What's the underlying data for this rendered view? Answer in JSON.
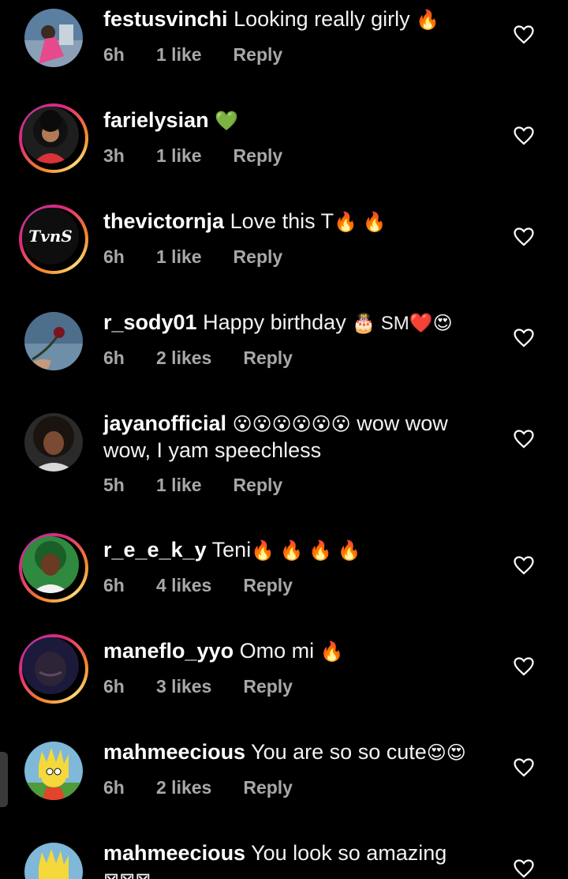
{
  "comments": [
    {
      "username": "festusvinchi",
      "text": "Looking really girly",
      "emoji": "🔥",
      "time": "6h",
      "likes": "1 like",
      "reply": "Reply"
    },
    {
      "username": "farielysian",
      "text": "",
      "emoji": "💚",
      "time": "3h",
      "likes": "1 like",
      "reply": "Reply"
    },
    {
      "username": "thevictornja",
      "text": "Love this T",
      "emoji": "🔥 🔥",
      "time": "6h",
      "likes": "1 like",
      "reply": "Reply",
      "avatar_text": "TvnS"
    },
    {
      "username": "r_sody01",
      "text": "Happy birthday",
      "emoji": "🎂 SM❤️😍",
      "time": "6h",
      "likes": "2 likes",
      "reply": "Reply"
    },
    {
      "username": "jayanofficial",
      "text": "",
      "emoji": "😮😮😮😮😮😮",
      "text2": "wow wow wow, I yam speechless",
      "time": "5h",
      "likes": "1 like",
      "reply": "Reply"
    },
    {
      "username": "r_e_e_k_y",
      "text": "Teni",
      "emoji": "🔥 🔥 🔥 🔥",
      "time": "6h",
      "likes": "4 likes",
      "reply": "Reply"
    },
    {
      "username": "maneflo_yyo",
      "text": "Omo mi",
      "emoji": "🔥",
      "time": "6h",
      "likes": "3 likes",
      "reply": "Reply"
    },
    {
      "username": "mahmeecious",
      "text": "You are so so cute",
      "emoji": "😍😍",
      "time": "6h",
      "likes": "2 likes",
      "reply": "Reply"
    },
    {
      "username": "mahmeecious",
      "text": "You look so amazing",
      "emoji": "⊠⊠⊠"
    }
  ],
  "colors": {
    "background": "#000000",
    "meta": "#a8a8a8",
    "story_ring_start": "#f58529",
    "story_ring_end": "#dd2a7b"
  }
}
